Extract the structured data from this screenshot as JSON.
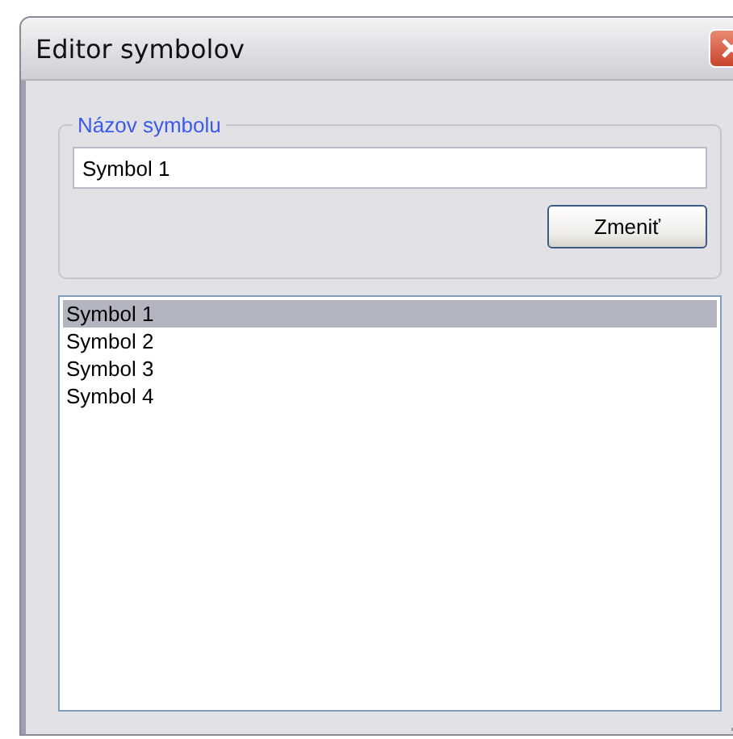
{
  "window": {
    "title": "Editor symbolov"
  },
  "group": {
    "legend": "Názov symbolu",
    "field_value": "Symbol 1",
    "button": "Zmeniť"
  },
  "list": {
    "items": [
      {
        "label": "Symbol 1",
        "selected": true
      },
      {
        "label": "Symbol 2",
        "selected": false
      },
      {
        "label": "Symbol 3",
        "selected": false
      },
      {
        "label": "Symbol 4",
        "selected": false
      }
    ]
  }
}
